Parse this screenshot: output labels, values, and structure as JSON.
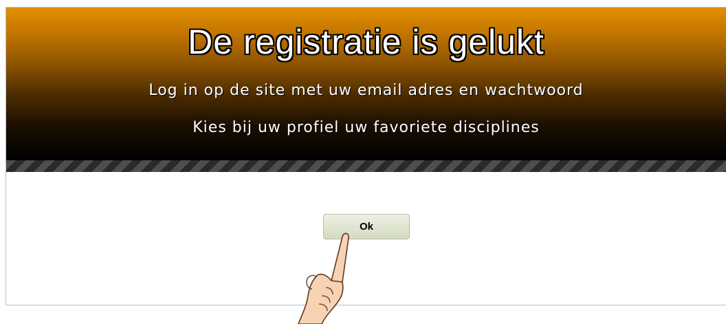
{
  "dialog": {
    "title": "De registratie is gelukt",
    "line1": "Log in op de site met uw email adres en wachtwoord",
    "line2": "Kies bij uw profiel uw favoriete disciplines",
    "ok_label": "Ok"
  },
  "colors": {
    "banner_top": "#e28f00",
    "banner_bottom": "#000000",
    "button_bg": "#dfe4cf",
    "border": "#a9c2e0"
  },
  "icons": {
    "pointer": "pointing-hand-icon"
  }
}
